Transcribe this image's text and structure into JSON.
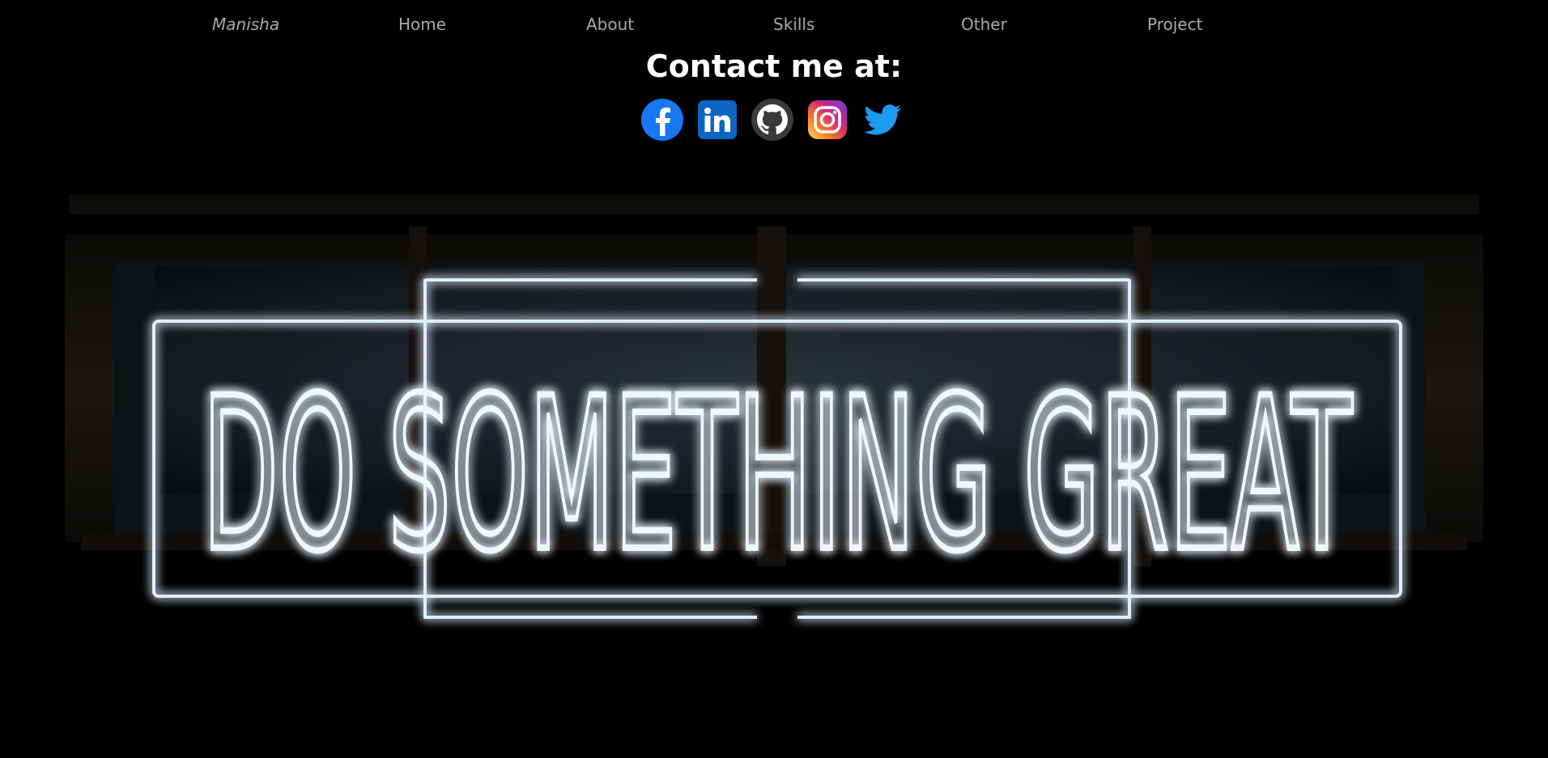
{
  "nav": {
    "brand": "Manisha",
    "items": [
      {
        "label": "Home"
      },
      {
        "label": "About"
      },
      {
        "label": "Skills"
      },
      {
        "label": "Other"
      },
      {
        "label": "Project"
      }
    ]
  },
  "contact": {
    "title": "Contact me at:",
    "socials": [
      {
        "name": "facebook-icon",
        "color": "#1877f2"
      },
      {
        "name": "linkedin-icon",
        "color": "#0a66c2"
      },
      {
        "name": "github-icon",
        "color": "#ffffff"
      },
      {
        "name": "instagram-icon",
        "color": "#e4405f"
      },
      {
        "name": "twitter-icon",
        "color": "#1d9bf0"
      }
    ]
  },
  "hero": {
    "neon_text": "DO SOMETHING GREAT",
    "background": "#000000",
    "neon_color": "#e8f3ff"
  }
}
